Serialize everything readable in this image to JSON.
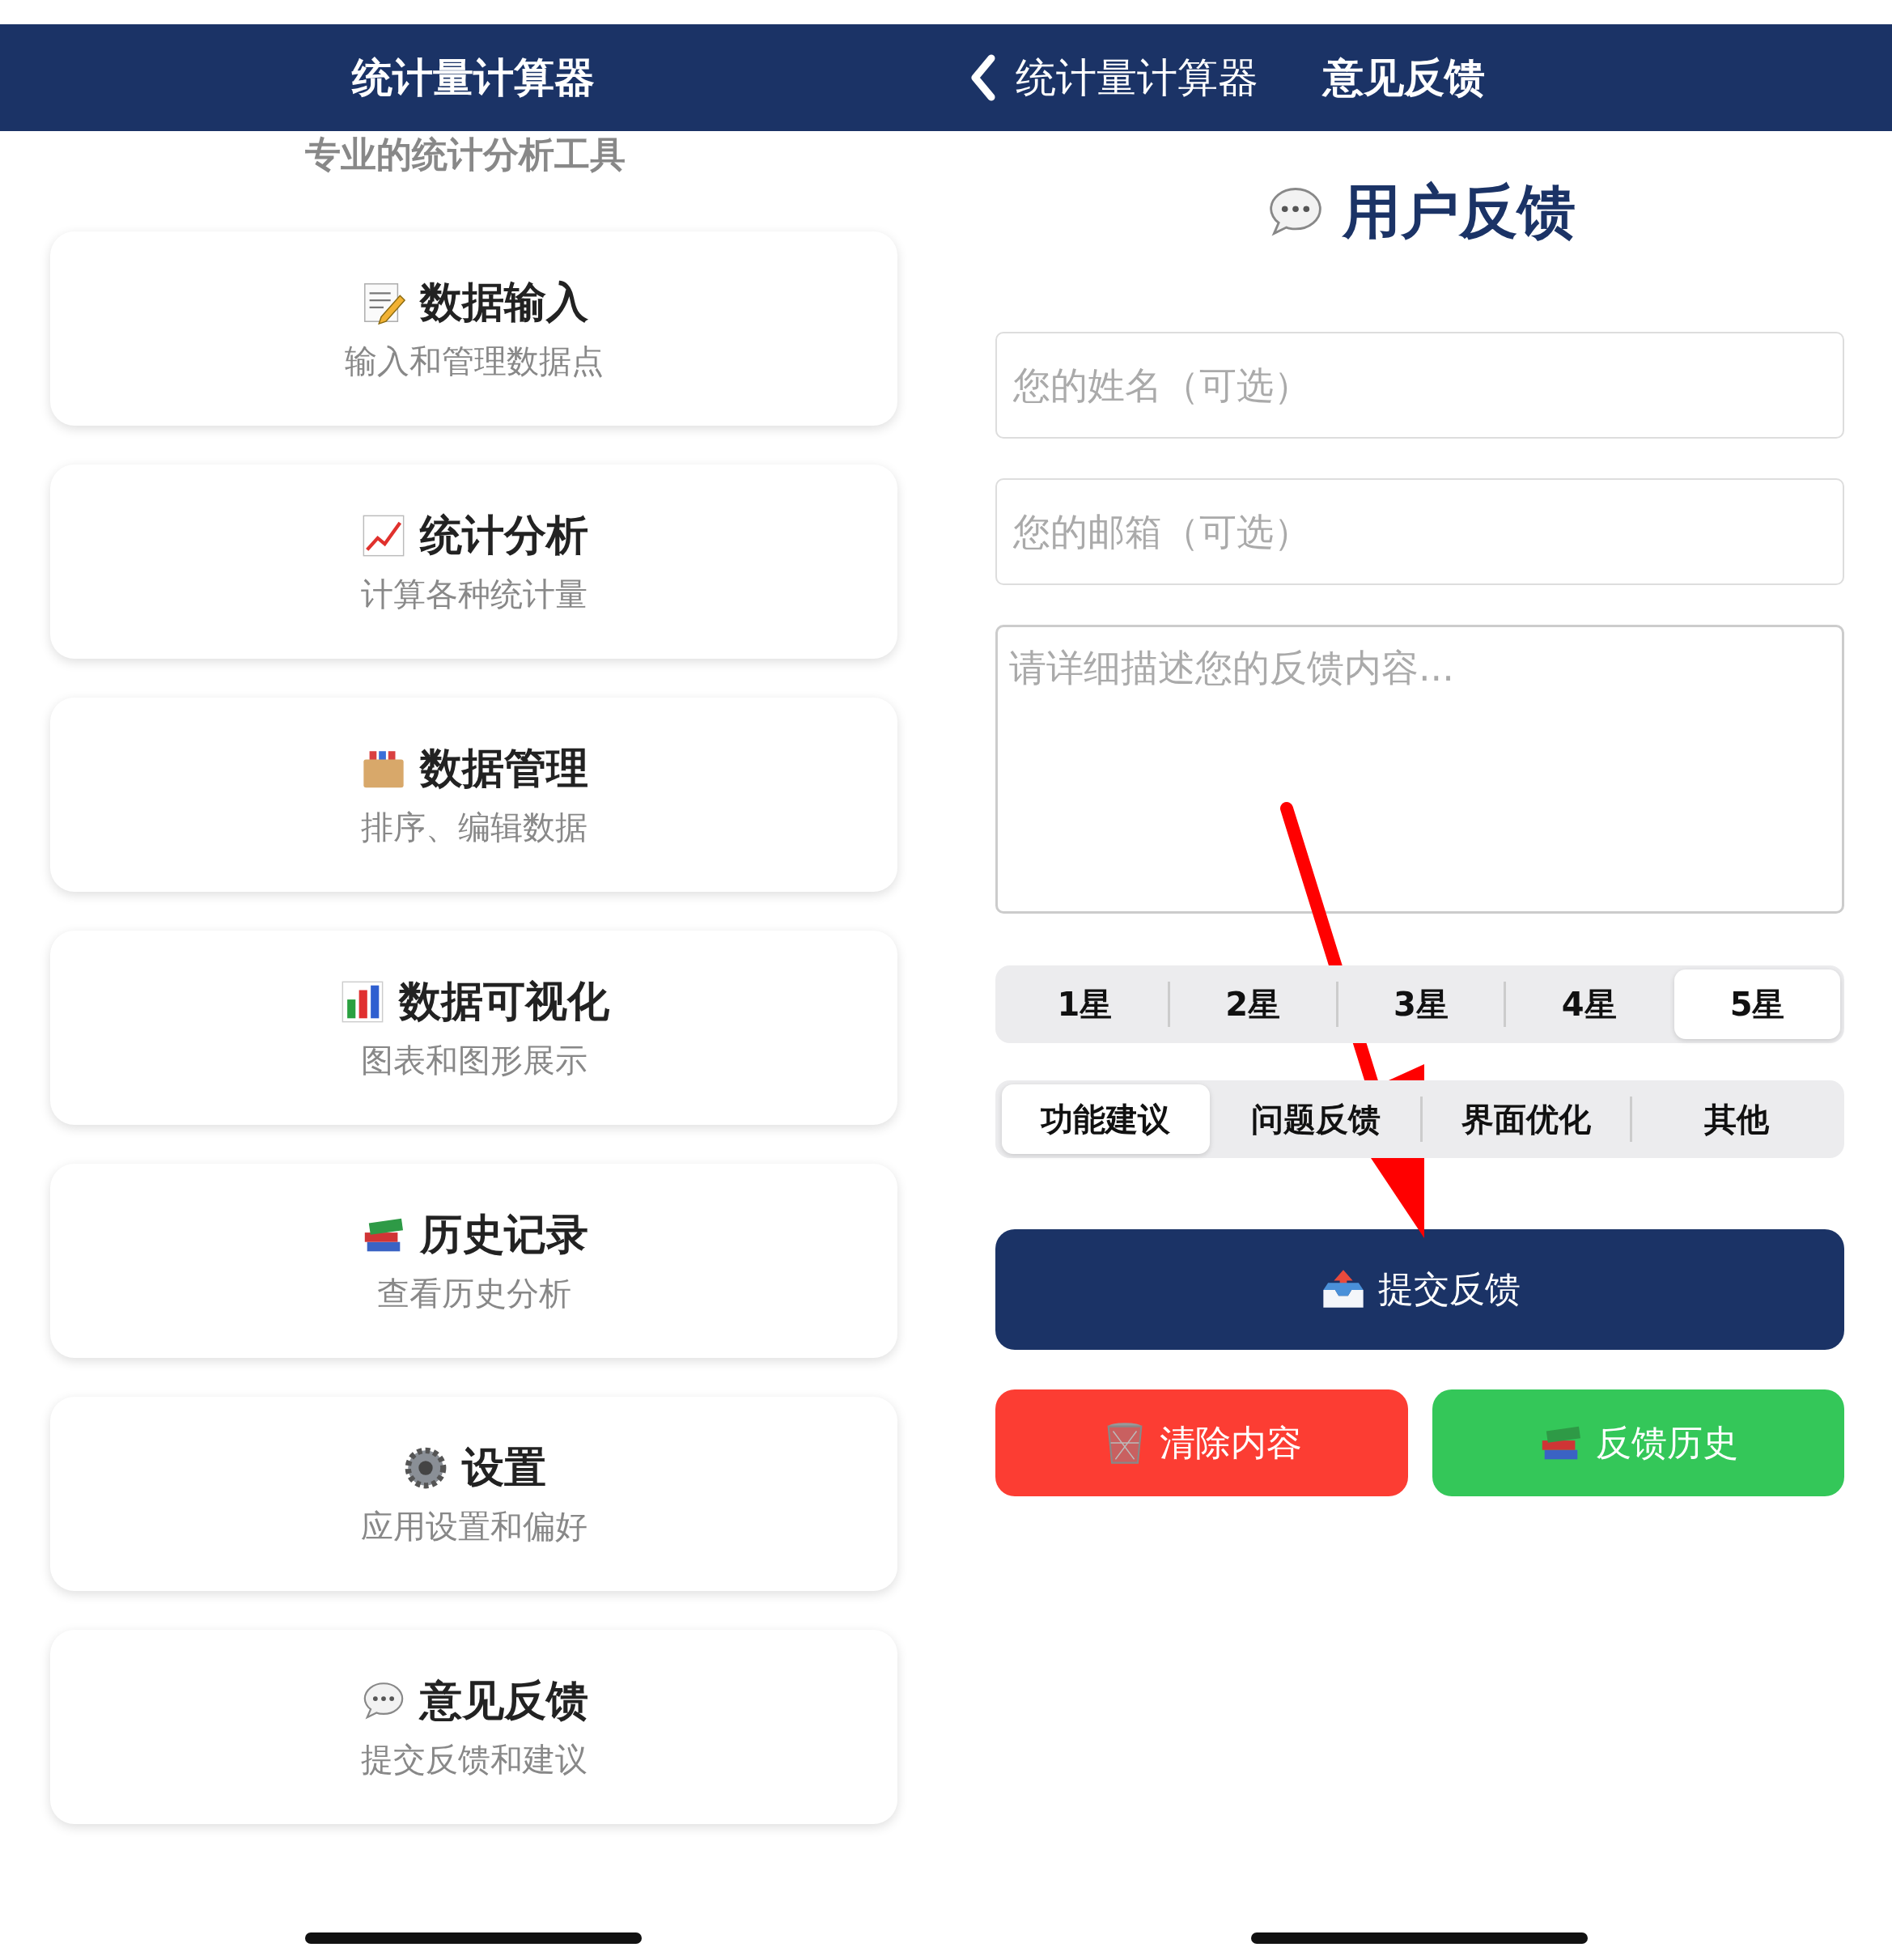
{
  "left_screen": {
    "nav_bar": {
      "title": "统计量计算器"
    },
    "subtitle": "专业的统计分析工具",
    "menu_cards": [
      {
        "kind": "input",
        "title": "数据输入",
        "description": "输入和管理数据点"
      },
      {
        "kind": "analysis",
        "title": "统计分析",
        "description": "计算各种统计量"
      },
      {
        "kind": "manage",
        "title": "数据管理",
        "description": "排序、编辑数据"
      },
      {
        "kind": "chart",
        "title": "数据可视化",
        "description": "图表和图形展示"
      },
      {
        "kind": "history",
        "title": "历史记录",
        "description": "查看历史分析"
      },
      {
        "kind": "settings",
        "title": "设置",
        "description": "应用设置和偏好"
      },
      {
        "kind": "feedback",
        "title": "意见反馈",
        "description": "提交反馈和建议"
      }
    ]
  },
  "right_screen": {
    "nav_bar": {
      "back_label": "统计量计算器",
      "title": "意见反馈"
    },
    "heading": "用户反馈",
    "name_field": {
      "placeholder": "您的姓名（可选）"
    },
    "email_field": {
      "placeholder": "您的邮箱（可选）"
    },
    "content_field": {
      "placeholder": "请详细描述您的反馈内容..."
    },
    "rating_options": [
      {
        "label": "1星",
        "selected": false
      },
      {
        "label": "2星",
        "selected": false
      },
      {
        "label": "3星",
        "selected": false
      },
      {
        "label": "4星",
        "selected": false
      },
      {
        "label": "5星",
        "selected": true
      }
    ],
    "category_options": [
      {
        "label": "功能建议",
        "selected": true
      },
      {
        "label": "问题反馈",
        "selected": false
      },
      {
        "label": "界面优化",
        "selected": false
      },
      {
        "label": "其他",
        "selected": false
      }
    ],
    "buttons": [
      {
        "kind": "submit",
        "label": "提交反馈"
      },
      {
        "kind": "clear",
        "label": "清除内容"
      },
      {
        "kind": "history",
        "label": "反馈历史"
      }
    ]
  }
}
